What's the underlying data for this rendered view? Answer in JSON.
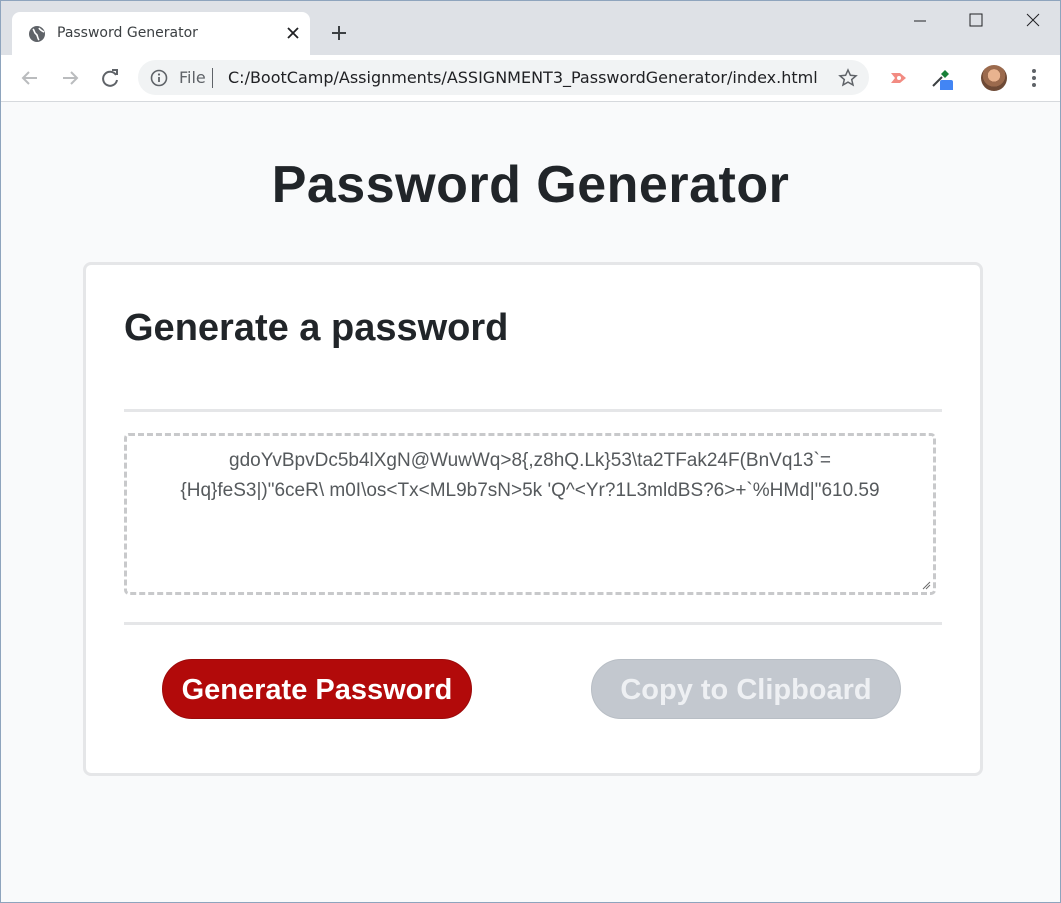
{
  "browser": {
    "tab_title": "Password Generator",
    "omnibox_file": "File",
    "url": "C:/BootCamp/Assignments/ASSIGNMENT3_PasswordGenerator/index.html"
  },
  "page": {
    "title": "Password Generator",
    "card_title": "Generate a password",
    "password_line1": "gdoYvBpvDc5b4lXgN@WuwWq>8{,z8hQ.Lk}53\\ta2TFak24F(BnVq13`=",
    "password_line2": "{Hq}feS3|)\"6ceR\\ m0I\\os<Tx<ML9b7sN>5k 'Q^<Yr?1L3mldBS?6>+`%HMd|\"610.59",
    "generate_label": "Generate Password",
    "copy_label": "Copy to Clipboard"
  },
  "colors": {
    "generate_button": "#b20a0a",
    "copy_button_disabled": "#c3c8cf"
  },
  "icons": [
    "globe-icon",
    "close-icon",
    "new-tab-icon",
    "minimize-icon",
    "maximize-icon",
    "window-close-icon",
    "back-icon",
    "forward-icon",
    "reload-icon",
    "info-icon",
    "star-icon",
    "extension-icon",
    "eyedropper-icon",
    "profile-avatar",
    "more-icon"
  ]
}
